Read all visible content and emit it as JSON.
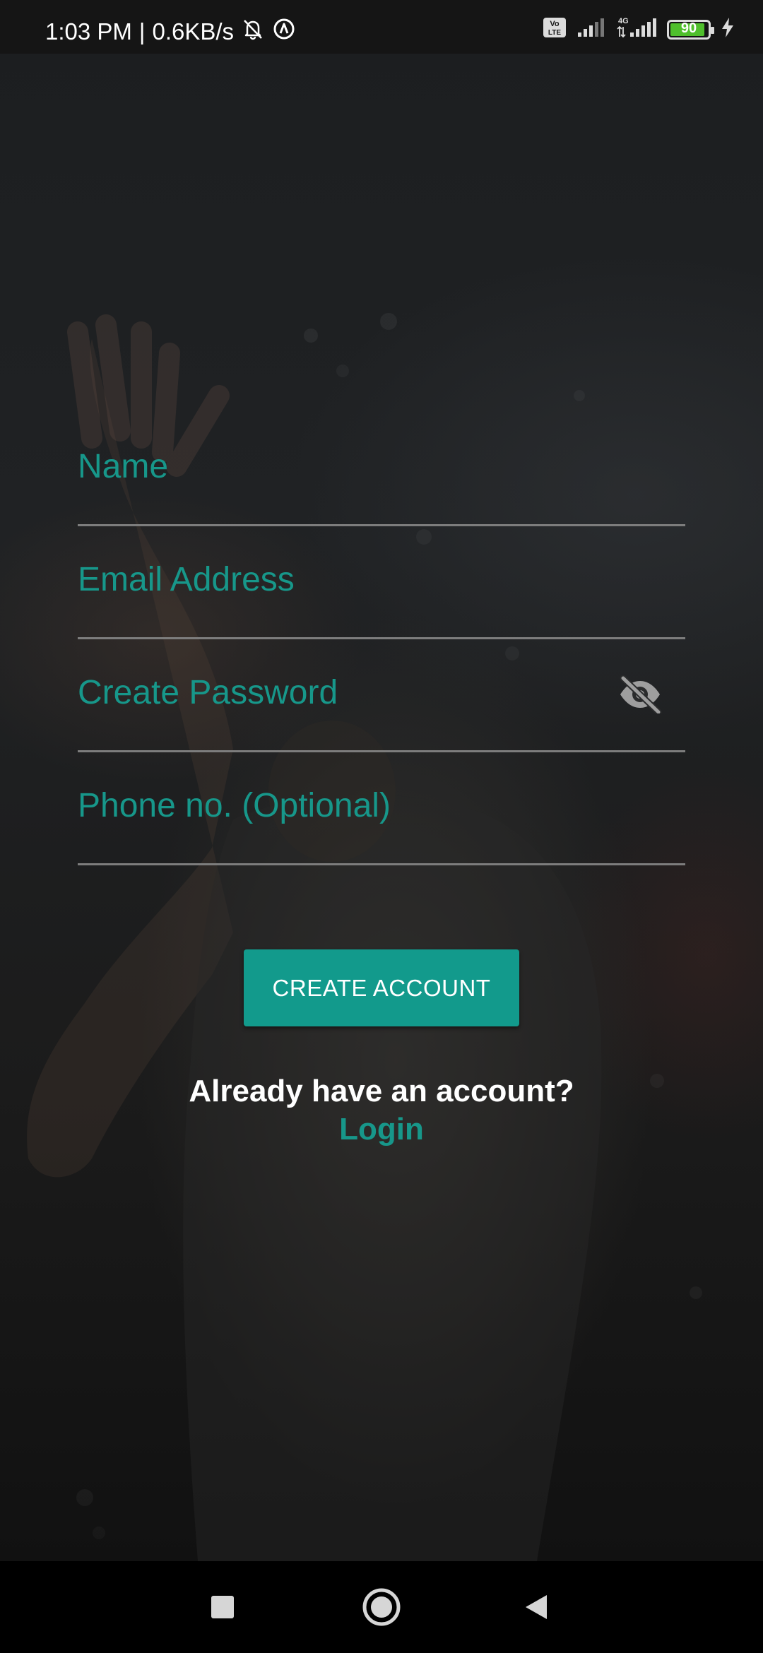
{
  "status_bar": {
    "time": "1:03 PM",
    "separator": "|",
    "network_speed": "0.6KB/s",
    "left_icons": [
      "bell-off-icon",
      "vpn-icon"
    ],
    "right_icons": [
      "volte-icon",
      "signal-icon",
      "4g-signal-icon",
      "battery-icon",
      "charging-icon"
    ],
    "volte_label": "Vo LTE",
    "network_type": "4G",
    "battery_level": "90"
  },
  "form": {
    "name_placeholder": "Name",
    "email_placeholder": "Email Address",
    "password_placeholder": "Create Password",
    "phone_placeholder": "Phone no. (Optional)",
    "password_toggle_icon": "eye-off-icon"
  },
  "actions": {
    "create_account_label": "CREATE ACCOUNT",
    "already_text": "Already have an account?",
    "login_label": "Login"
  },
  "nav_bar": {
    "icons": [
      "recents-icon",
      "home-icon",
      "back-icon"
    ]
  },
  "colors": {
    "accent": "#129a8c",
    "placeholder": "#17978a",
    "background": "#1c1e20",
    "divider": "#7d7d7d",
    "battery_fill": "#4fbf2c"
  }
}
